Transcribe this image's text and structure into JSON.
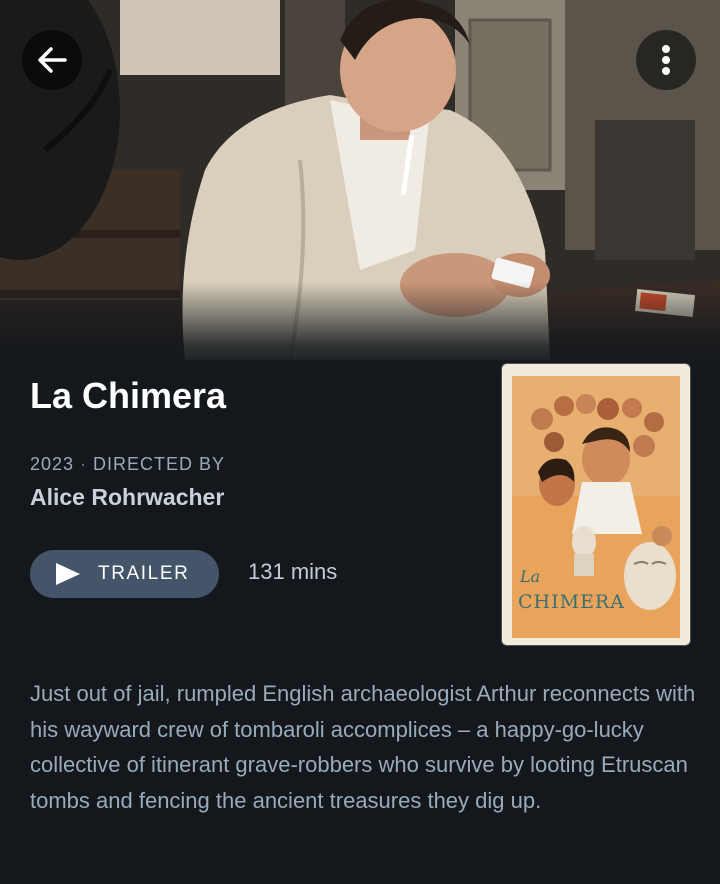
{
  "nav": {
    "back_icon": "arrow-left-icon",
    "more_icon": "vertical-dots-icon"
  },
  "film": {
    "title": "La Chimera",
    "year": "2023",
    "separator": "·",
    "directed_by_label": "DIRECTED BY",
    "director": "Alice Rohrwacher",
    "runtime": "131 mins",
    "synopsis": "Just out of jail, rumpled English archaeologist Arthur reconnects with his wayward crew of tombaroli accomplices – a happy-go-lucky collective of itinerant grave-robbers who survive by looting Etruscan tombs and fencing the ancient treasures they dig up."
  },
  "trailer": {
    "label": "TRAILER",
    "icon": "play-icon"
  },
  "poster": {
    "logo_line1": "La",
    "logo_line2": "CHIMERA"
  },
  "colors": {
    "background": "#14181c",
    "button": "#44556a",
    "muted_text": "#99aabb"
  }
}
